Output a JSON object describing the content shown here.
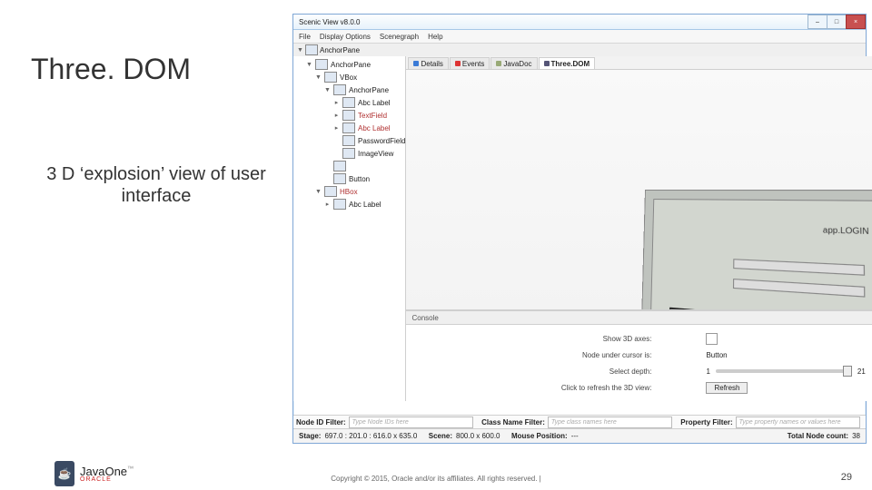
{
  "slide": {
    "title": "Three. DOM",
    "subtitle": "3 D ‘explosion’ view of user interface",
    "copyright": "Copyright © 2015, Oracle and/or its affiliates. All rights reserved.  |",
    "page": "29",
    "brand1": "JavaOne",
    "brand2": "ORACLE"
  },
  "app": {
    "title": "Scenic View v8.0.0",
    "menu": [
      "File",
      "Display Options",
      "Scenegraph",
      "Help"
    ],
    "tree_root": "AnchorPane",
    "tree": [
      {
        "ind": 1,
        "tw": "▼",
        "label": "AnchorPane"
      },
      {
        "ind": 2,
        "tw": "▼",
        "label": "VBox"
      },
      {
        "ind": 3,
        "tw": "▼",
        "label": "AnchorPane"
      },
      {
        "ind": 4,
        "tw": "▸",
        "label": "Abc  Label"
      },
      {
        "ind": 4,
        "tw": "▸",
        "label": "TextField",
        "cls": "tred"
      },
      {
        "ind": 4,
        "tw": "▸",
        "label": "Abc  Label",
        "cls": "tred"
      },
      {
        "ind": 4,
        "tw": "",
        "label": "PasswordField"
      },
      {
        "ind": 4,
        "tw": "",
        "label": "ImageView"
      },
      {
        "ind": 3,
        "tw": "",
        "label": ""
      },
      {
        "ind": 3,
        "tw": "",
        "label": "Button"
      },
      {
        "ind": 2,
        "tw": "▼",
        "label": "HBox",
        "cls": "tred"
      },
      {
        "ind": 3,
        "tw": "▸",
        "label": "Abc  Label"
      }
    ],
    "tabs": [
      {
        "label": "Details",
        "color": "#3a7ad6"
      },
      {
        "label": "Events",
        "color": "#d33"
      },
      {
        "label": "JavaDoc",
        "color": "#9a7"
      },
      {
        "label": "Three.DOM",
        "color": "#557",
        "active": true
      }
    ],
    "viewport_text": "app.LOGIN",
    "console_label": "Console",
    "controls": {
      "show_axes": {
        "label": "Show 3D axes:"
      },
      "node_cursor": {
        "label": "Node under cursor is:",
        "value": "Button"
      },
      "depth": {
        "label": "Select depth:",
        "min": "1",
        "max": "21"
      },
      "refresh": {
        "label": "Click to refresh the 3D view:",
        "btn": "Refresh"
      }
    },
    "filters": {
      "node": {
        "label": "Node ID Filter:",
        "ph": "Type Node IDs here"
      },
      "class": {
        "label": "Class Name Filter:",
        "ph": "Type class names here"
      },
      "prop": {
        "label": "Property Filter:",
        "ph": "Type property names or values here"
      }
    },
    "status": {
      "stage_l": "Stage:",
      "stage_v": "697.0 : 201.0 : 616.0 x 635.0",
      "scene_l": "Scene:",
      "scene_v": "800.0 x 600.0",
      "mouse_l": "Mouse Position:",
      "mouse_v": "---",
      "count_l": "Total Node count:",
      "count_v": "38"
    }
  }
}
